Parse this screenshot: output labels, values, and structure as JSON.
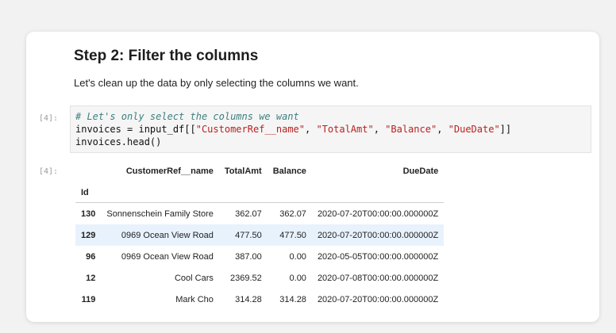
{
  "notebook": {
    "heading": "Step 2: Filter the columns",
    "description": "Let's clean up the data by only selecting the columns we want.",
    "input_prompt": "[4]:",
    "output_prompt": "[4]:",
    "code": {
      "line1_comment": "# Let's only select the columns we want",
      "line2_prefix": "invoices = input_df[[",
      "str1": "\"CustomerRef__name\"",
      "str2": "\"TotalAmt\"",
      "str3": "\"Balance\"",
      "str4": "\"DueDate\"",
      "sep": ", ",
      "line2_suffix": "]]",
      "line3": "invoices.head()"
    }
  },
  "table": {
    "index_name": "Id",
    "columns": [
      "CustomerRef__name",
      "TotalAmt",
      "Balance",
      "DueDate"
    ],
    "rows": [
      {
        "id": "130",
        "cells": [
          "Sonnenschein Family Store",
          "362.07",
          "362.07",
          "2020-07-20T00:00:00.000000Z"
        ]
      },
      {
        "id": "129",
        "cells": [
          "0969 Ocean View Road",
          "477.50",
          "477.50",
          "2020-07-20T00:00:00.000000Z"
        ]
      },
      {
        "id": "96",
        "cells": [
          "0969 Ocean View Road",
          "387.00",
          "0.00",
          "2020-05-05T00:00:00.000000Z"
        ]
      },
      {
        "id": "12",
        "cells": [
          "Cool Cars",
          "2369.52",
          "0.00",
          "2020-07-08T00:00:00.000000Z"
        ]
      },
      {
        "id": "119",
        "cells": [
          "Mark Cho",
          "314.28",
          "314.28",
          "2020-07-20T00:00:00.000000Z"
        ]
      }
    ],
    "highlight_color": "#e8f2fd"
  }
}
